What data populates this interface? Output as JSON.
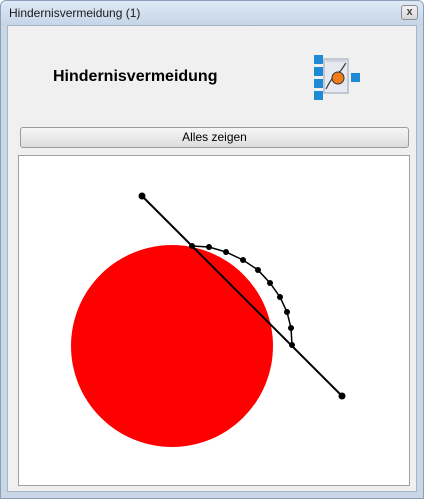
{
  "window": {
    "title": "Hindernisvermeidung (1)",
    "close_glyph": "x"
  },
  "header": {
    "title": "Hindernisvermeidung",
    "logo_icon": "obstacle-avoidance-logo-icon"
  },
  "toolbar": {
    "show_all_label": "Alles zeigen"
  },
  "colors": {
    "obstacle": "#ff0000",
    "path": "#000000"
  }
}
